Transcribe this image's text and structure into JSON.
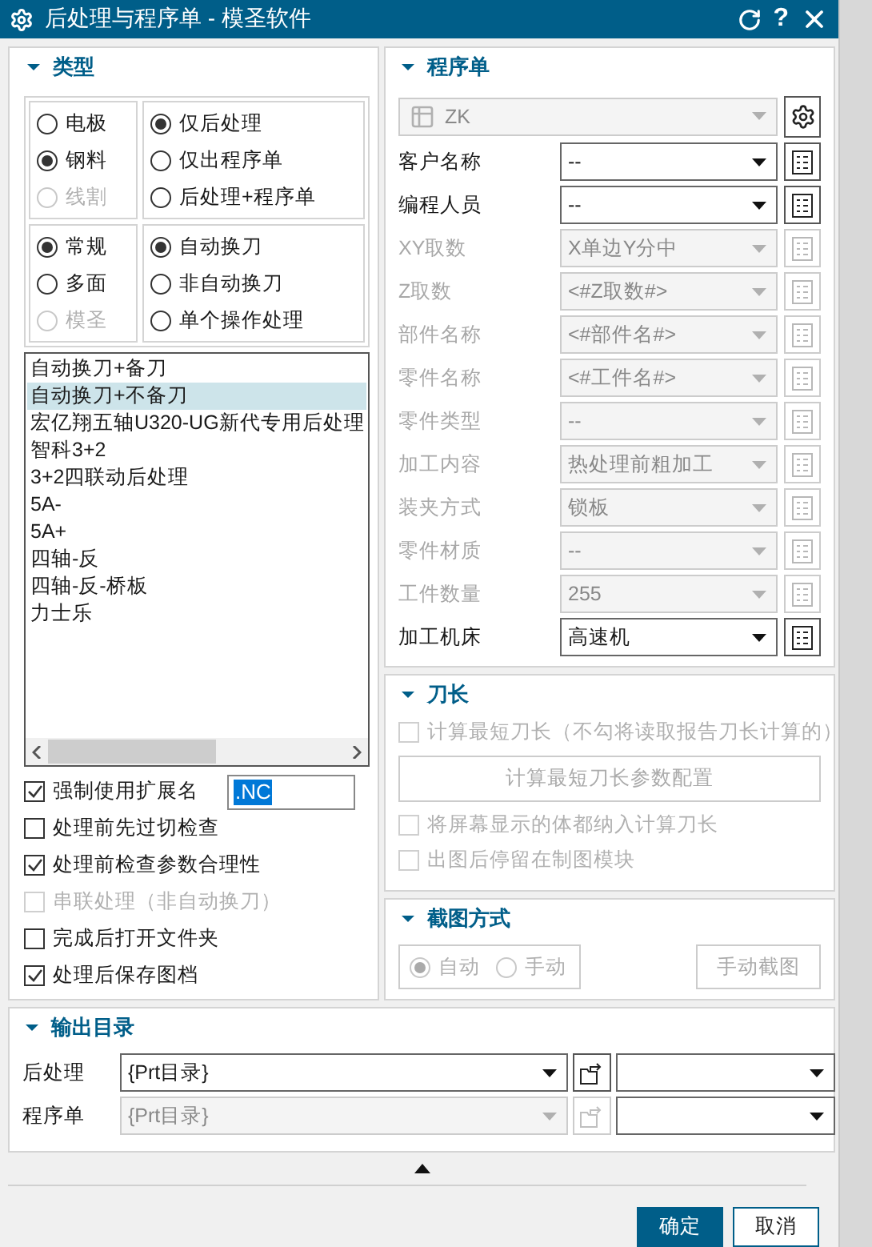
{
  "window": {
    "title": "后处理与程序单 - 模圣软件",
    "help_button": "?"
  },
  "type_section": {
    "title": "类型",
    "expanded": true,
    "radio_groups": [
      [
        {
          "label": "电极",
          "selected": false,
          "disabled": false
        },
        {
          "label": "钢料",
          "selected": true,
          "disabled": false
        },
        {
          "label": "线割",
          "selected": false,
          "disabled": true
        }
      ],
      [
        {
          "label": "仅后处理",
          "selected": true,
          "disabled": false
        },
        {
          "label": "仅出程序单",
          "selected": false,
          "disabled": false
        },
        {
          "label": "后处理+程序单",
          "selected": false,
          "disabled": false
        }
      ],
      [
        {
          "label": "常规",
          "selected": true,
          "disabled": false
        },
        {
          "label": "多面",
          "selected": false,
          "disabled": false
        },
        {
          "label": "模圣",
          "selected": false,
          "disabled": true
        }
      ],
      [
        {
          "label": "自动换刀",
          "selected": true,
          "disabled": false
        },
        {
          "label": "非自动换刀",
          "selected": false,
          "disabled": false
        },
        {
          "label": "单个操作处理",
          "selected": false,
          "disabled": false
        }
      ]
    ],
    "postprocessors": [
      {
        "label": "自动换刀+备刀",
        "selected": false
      },
      {
        "label": "自动换刀+不备刀",
        "selected": true
      },
      {
        "label": "宏亿翔五轴U320-UG新代专用后处理",
        "selected": false
      },
      {
        "label": "智科3+2",
        "selected": false
      },
      {
        "label": "3+2四联动后处理",
        "selected": false
      },
      {
        "label": "5A-",
        "selected": false
      },
      {
        "label": "5A+",
        "selected": false
      },
      {
        "label": "四轴-反",
        "selected": false
      },
      {
        "label": "四轴-反-桥板",
        "selected": false
      },
      {
        "label": "力士乐",
        "selected": false
      }
    ],
    "extension": {
      "label": "强制使用扩展名",
      "checked": true,
      "value": ".NC"
    },
    "options": [
      {
        "label": "处理前先过切检查",
        "checked": false,
        "disabled": false
      },
      {
        "label": "处理前检查参数合理性",
        "checked": true,
        "disabled": false
      },
      {
        "label": "串联处理（非自动换刀）",
        "checked": false,
        "disabled": true
      },
      {
        "label": "完成后打开文件夹",
        "checked": false,
        "disabled": false
      },
      {
        "label": "处理后保存图档",
        "checked": true,
        "disabled": false
      }
    ]
  },
  "program_sheet": {
    "title": "程序单",
    "expanded": true,
    "template": {
      "value": "ZK",
      "disabled": true
    },
    "fields": [
      {
        "label": "客户名称",
        "value": "--",
        "disabled": false
      },
      {
        "label": "编程人员",
        "value": "--",
        "disabled": false
      },
      {
        "label": "XY取数",
        "value": "X单边Y分中",
        "disabled": true
      },
      {
        "label": "Z取数",
        "value": "<#Z取数#>",
        "disabled": true
      },
      {
        "label": "部件名称",
        "value": "<#部件名#>",
        "disabled": true
      },
      {
        "label": "零件名称",
        "value": "<#工件名#>",
        "disabled": true
      },
      {
        "label": "零件类型",
        "value": "--",
        "disabled": true
      },
      {
        "label": "加工内容",
        "value": "热处理前粗加工",
        "disabled": true
      },
      {
        "label": "装夹方式",
        "value": "锁板",
        "disabled": true
      },
      {
        "label": "零件材质",
        "value": "--",
        "disabled": true
      },
      {
        "label": "工件数量",
        "value": "255",
        "disabled": true
      },
      {
        "label": "加工机床",
        "value": "高速机",
        "disabled": false
      }
    ]
  },
  "tool_length": {
    "title": "刀长",
    "expanded": true,
    "items": [
      {
        "kind": "checkbox",
        "label": "计算最短刀长（不勾将读取报告刀长计算的）",
        "checked": false,
        "disabled": true
      },
      {
        "kind": "button",
        "label": "计算最短刀长参数配置",
        "disabled": true
      },
      {
        "kind": "checkbox",
        "label": "将屏幕显示的体都纳入计算刀长",
        "checked": false,
        "disabled": true
      },
      {
        "kind": "checkbox",
        "label": "出图后停留在制图模块",
        "checked": false,
        "disabled": true
      }
    ]
  },
  "screenshot": {
    "title": "截图方式",
    "expanded": true,
    "disabled": true,
    "modes": [
      {
        "label": "自动",
        "selected": true
      },
      {
        "label": "手动",
        "selected": false
      }
    ],
    "button": "手动截图"
  },
  "output_dir": {
    "title": "输出目录",
    "expanded": true,
    "rows": [
      {
        "label": "后处理",
        "value": "{Prt目录}",
        "disabled": false
      },
      {
        "label": "程序单",
        "value": "{Prt目录}",
        "disabled": true
      }
    ]
  },
  "buttons": [
    {
      "label": "确定",
      "primary": true
    },
    {
      "label": "取消",
      "primary": false
    }
  ]
}
